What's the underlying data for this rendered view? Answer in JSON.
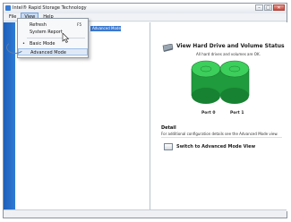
{
  "window": {
    "title": "Intel® Rapid Storage Technology",
    "controls": {
      "minimize": "–",
      "maximize": "□",
      "close": "✕"
    }
  },
  "menubar": {
    "items": [
      {
        "label": "File"
      },
      {
        "label": "View"
      },
      {
        "label": "Help"
      }
    ]
  },
  "view_menu": {
    "items": [
      {
        "label": "Refresh",
        "shortcut": "F5"
      },
      {
        "label": "System Report",
        "shortcut": ""
      },
      {
        "label": "Basic Mode",
        "shortcut": "",
        "checked": true
      },
      {
        "label": "Advanced Mode",
        "shortcut": "",
        "highlighted": true
      }
    ]
  },
  "tree": {
    "selected_item": "Advanced Mode"
  },
  "status_panel": {
    "title": "View Hard Drive and Volume Status",
    "subtitle": "All hard drives and volumes are OK.",
    "disks": [
      {
        "label": "Port 0"
      },
      {
        "label": "Port 1"
      }
    ],
    "disk_color": "#2fb84a"
  },
  "detail": {
    "title": "Detail",
    "body": "For additional configuration details see the Advanced Mode view.",
    "switch_link": "Switch to Advanced Mode View"
  },
  "colors": {
    "sidebar_blue": "#1e5fb8",
    "selection_blue": "#3a78cf"
  }
}
